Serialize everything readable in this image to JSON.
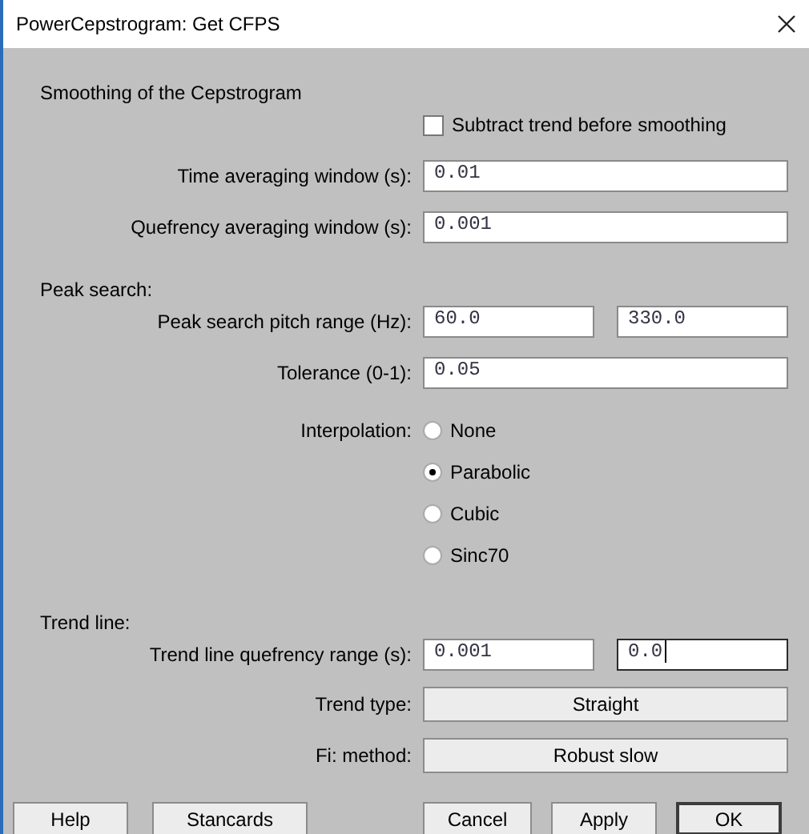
{
  "window": {
    "title": "PowerCepstrogram: Get CFPS"
  },
  "sections": [
    {
      "heading": "Smoothing of the Cepstrogram",
      "fields": [
        {
          "kind": "checkbox",
          "label": "Subtract trend before smoothing",
          "checked": false
        },
        {
          "kind": "text",
          "label": "Time averaging window (s):",
          "values": [
            {
              "value": "0.01",
              "focused": false
            }
          ]
        },
        {
          "kind": "text",
          "label": "Quefrency averaging window (s):",
          "values": [
            {
              "value": "0.001",
              "focused": false
            }
          ]
        }
      ]
    },
    {
      "heading": "Peak search:",
      "fields": [
        {
          "kind": "text",
          "label": "Peak search pitch range (Hz):",
          "values": [
            {
              "value": "60.0",
              "focused": false
            },
            {
              "value": "330.0",
              "focused": false
            }
          ]
        },
        {
          "kind": "text",
          "label": "Tolerance (0-1):",
          "values": [
            {
              "value": "0.05",
              "focused": false
            }
          ]
        },
        {
          "kind": "radio",
          "label": "Interpolation:",
          "options": [
            {
              "label": "None",
              "selected": false
            },
            {
              "label": "Parabolic",
              "selected": true
            },
            {
              "label": "Cubic",
              "selected": false
            },
            {
              "label": "Sinc70",
              "selected": false
            }
          ]
        }
      ]
    },
    {
      "heading": "Trend line:",
      "fields": [
        {
          "kind": "text",
          "label": "Trend line quefrency range (s):",
          "values": [
            {
              "value": "0.001",
              "focused": false
            },
            {
              "value": "0.0",
              "focused": true
            }
          ]
        },
        {
          "kind": "option_menu",
          "label": "Trend type:",
          "value": "Straight"
        },
        {
          "kind": "option_menu",
          "label": "Fi: method:",
          "value": "Robust slow"
        }
      ]
    }
  ],
  "buttons": [
    {
      "label": "Help",
      "default": false
    },
    {
      "label": "Stancards",
      "default": false
    },
    {
      "label": "Cancel",
      "default": false
    },
    {
      "label": "Apply",
      "default": false
    },
    {
      "label": "OK",
      "default": true
    }
  ]
}
